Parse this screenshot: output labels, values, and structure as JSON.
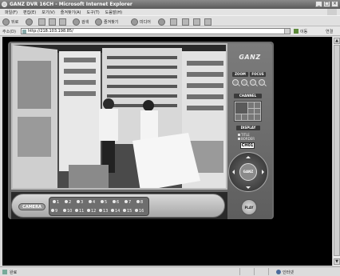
{
  "window": {
    "title": "GANZ DVR 16CH - Microsoft Internet Explorer",
    "minimize": "_",
    "maximize": "□",
    "close": "×"
  },
  "menu": [
    "파일(F)",
    "편집(E)",
    "보기(V)",
    "즐겨찾기(A)",
    "도구(T)",
    "도움말(H)"
  ],
  "toolbar": {
    "back": "뒤로",
    "search": "검색",
    "favorites": "즐겨찾기",
    "media": "미디어"
  },
  "address": {
    "label": "주소(D)",
    "url": "http://218.103.198.85/",
    "go": "이동",
    "links": "연결"
  },
  "dvr": {
    "brand": "GANZ",
    "zoom_label": "ZOOM",
    "focus_label": "FOCUS",
    "channel_label": "CHANNEL",
    "display_label": "DISPLAY",
    "title_label": "TITLE",
    "border_label": "BORDER",
    "current_channel": "CH01",
    "jog_label": "GANZ",
    "camera_button": "CAMERA",
    "play_button": "PLAY",
    "channels": [
      "1",
      "2",
      "3",
      "4",
      "5",
      "6",
      "7",
      "8",
      "9",
      "10",
      "11",
      "12",
      "13",
      "14",
      "15",
      "16"
    ]
  },
  "status": {
    "text": "완료",
    "zone": "인터넷"
  },
  "colors": {
    "titlebar": "#6e6e6e",
    "panel": "#6a6a6a"
  }
}
